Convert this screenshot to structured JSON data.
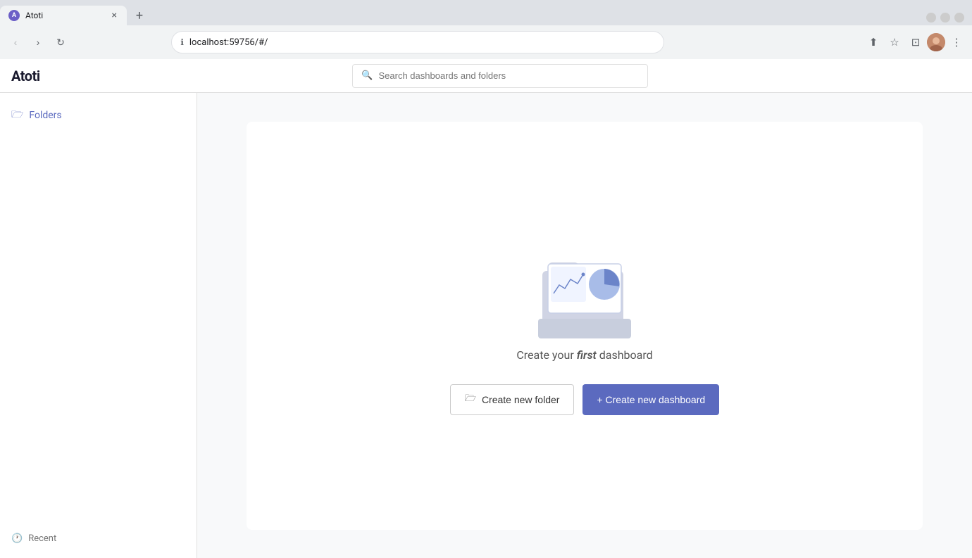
{
  "browser": {
    "tab": {
      "title": "Atoti",
      "favicon_label": "A",
      "close_label": "×"
    },
    "new_tab_label": "+",
    "window_controls": {
      "minimize": "–",
      "maximize": "□",
      "close": "×"
    },
    "toolbar": {
      "back_label": "‹",
      "forward_label": "›",
      "refresh_label": "↻",
      "address": "localhost:59756/#/",
      "address_icon": "ℹ",
      "share_label": "⬆",
      "bookmark_label": "☆",
      "tab_strip_label": "⊡",
      "menu_label": "⋮"
    }
  },
  "app": {
    "logo": "Atoti",
    "search": {
      "placeholder": "Search dashboards and folders"
    },
    "sidebar": {
      "folders_label": "Folders",
      "recent_label": "Recent"
    },
    "main": {
      "empty_state": {
        "title_prefix": "Create your ",
        "title_highlight": "first",
        "title_suffix": " dashboard",
        "btn_folder_label": "Create new folder",
        "btn_dashboard_label": "+ Create new dashboard"
      }
    }
  }
}
